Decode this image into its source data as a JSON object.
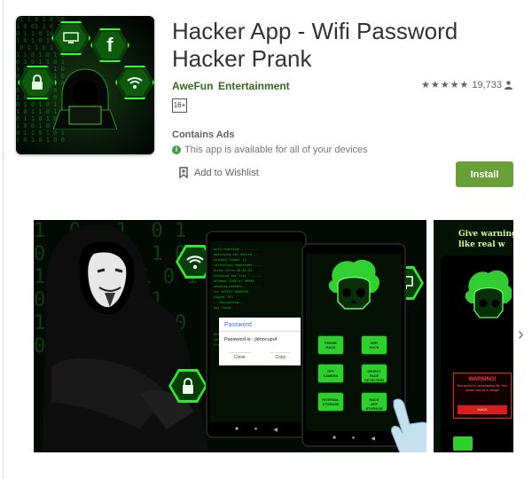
{
  "app": {
    "title": "Hacker App - Wifi Password Hacker Prank",
    "developer": "AweFun",
    "category": "Entertainment",
    "rating_stars": "★★★★★",
    "rating_count": "19,733",
    "content_rating": "16+",
    "ads_label": "Contains Ads",
    "availability": "This app is available for all of your devices",
    "wishlist_label": "Add to Wishlist",
    "install_label": "Install"
  },
  "icon": {
    "letter": "f",
    "matrix": "01 1 0 1 0 10\n1 0 01 1 0 1 0\n0 1 1 0 10 1 1\n1 0 1 0 1 1 0\n 0 1 1 0 1 0 1\n1 1 0 1 0 1 0\n0 1 0 1 1 0 1\n1 0 1 0 0 1 0\n0 1 1 0 1 1 0\n1 0 1 1 0 1 0\n0 1 0 1 1 0 1\n1 0 1 0 1 0 1\n0 1 0 1 0 1 1\n1 0 1 1 0 1 0\n0 1 1 0 1 0 1\n1 0 0 1 0 1 0\n0 1 1 0 1 0 1\n1 0 1 0 1 0 0"
  },
  "screenshots": {
    "matrix": "1  0   1  0 1\n0 1 0 1 0 1 0\n1 0 1 0  1 0 1\n0 0 1 0 1 1\n1 0 1 0 0 1 0\n0 1 0 1 1  0",
    "dialog_title": "Password",
    "dialog_body": "Password is : jldnocupuf",
    "dialog_close": "Close",
    "dialog_copy": "Copy",
    "terminal": "wifi scanning ..........\nsearching for device ...\nnetwork found: 12\ncollecting handshake ....\nbrute force 00:01:23\nchecking key list .......\nattempt 1203 of 99999\nsending packets .........\n>>> ACCESS GRANTED\nsignal 72%\n-- decrypting --\nkey found ...\n\n\n\n\nHash: 8f1a9c\nLength: 10\nCracked successfully",
    "buttons": [
      "PHONE\nHACK",
      "WIFI\nHACK",
      "SPY\nCAMERA",
      "OBJECT\nFACE\nDETECTION",
      "INTERNAL\nSTORAGE",
      "HACK\nAPP\nSTORAGE"
    ],
    "side_title": "Give warning\nlike real w",
    "warning_title": "WARNING!",
    "warning_body": "Bad symbol in downloading file. Your device may be in danger",
    "warning_button": "HACK"
  }
}
